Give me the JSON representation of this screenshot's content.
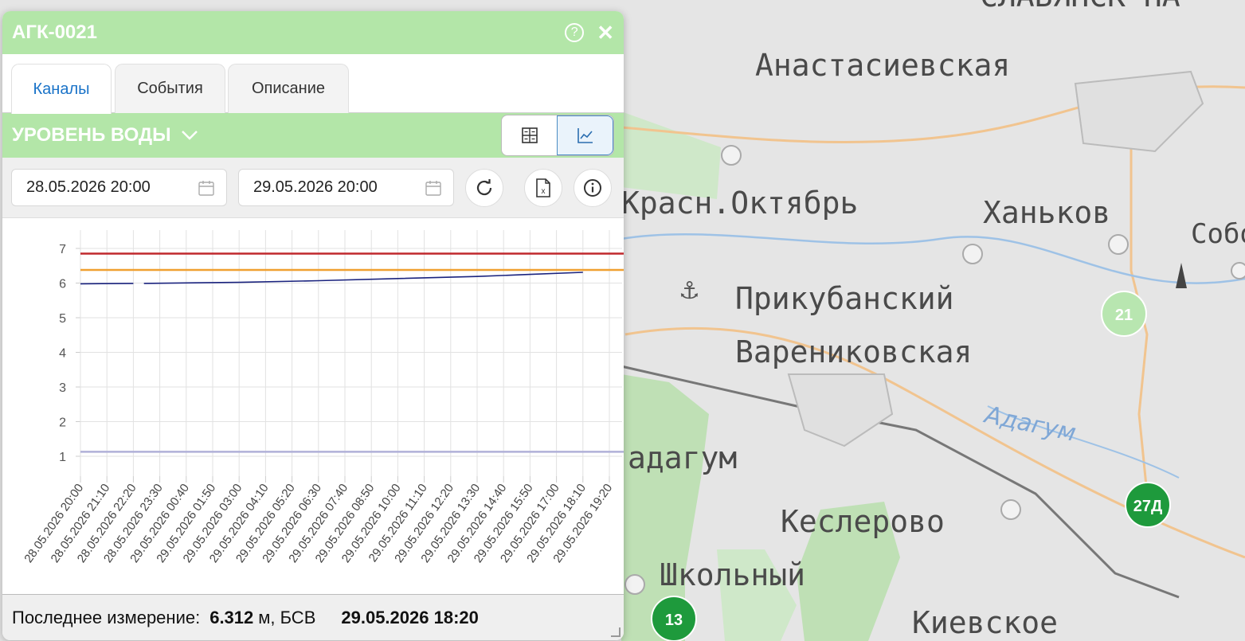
{
  "window": {
    "title": "АГК-0021",
    "help_icon": "help-icon",
    "close_icon": "close-icon"
  },
  "tabs": [
    {
      "label": "Каналы",
      "active": true
    },
    {
      "label": "События",
      "active": false
    },
    {
      "label": "Описание",
      "active": false
    }
  ],
  "channel": {
    "selected": "УРОВЕНЬ ВОДЫ",
    "view_modes": [
      "table-view-icon",
      "chart-view-icon"
    ],
    "active_view": "chart"
  },
  "filters": {
    "date_from": "28.05.2026 20:00",
    "date_to": "29.05.2026 20:00",
    "buttons": [
      "refresh-icon",
      "excel-export-icon",
      "info-icon"
    ]
  },
  "chart_data": {
    "type": "line",
    "ylim": [
      0,
      7
    ],
    "y_ticks": [
      "1",
      "2",
      "3",
      "4",
      "5",
      "6",
      "7"
    ],
    "x_ticks": [
      "28.05.2026 20:00",
      "28.05.2026 21:10",
      "28.05.2026 22:20",
      "28.05.2026 23:30",
      "29.05.2026 00:40",
      "29.05.2026 01:50",
      "29.05.2026 03:00",
      "29.05.2026 04:10",
      "29.05.2026 05:20",
      "29.05.2026 06:30",
      "29.05.2026 07:40",
      "29.05.2026 08:50",
      "29.05.2026 10:00",
      "29.05.2026 11:10",
      "29.05.2026 12:20",
      "29.05.2026 13:30",
      "29.05.2026 14:40",
      "29.05.2026 15:50",
      "29.05.2026 17:00",
      "29.05.2026 18:10",
      "29.05.2026 19:20"
    ],
    "grid": true,
    "thresholds": [
      {
        "value": 6.85,
        "color": "#c0282d"
      },
      {
        "value": 6.38,
        "color": "#f0a030"
      },
      {
        "value": 1.13,
        "color": "#b0b0d8"
      }
    ],
    "series": [
      {
        "color": "#1a237e",
        "segments": [
          [
            [
              0,
              5.98
            ],
            [
              2.0,
              5.99
            ]
          ],
          [
            [
              2.4,
              5.99
            ],
            [
              6,
              6.02
            ],
            [
              9,
              6.07
            ],
            [
              12,
              6.13
            ],
            [
              15,
              6.19
            ],
            [
              17,
              6.25
            ],
            [
              19,
              6.31
            ]
          ]
        ]
      }
    ]
  },
  "footer": {
    "label": "Последнее измерение:",
    "value": "6.312",
    "unit": "м, БСВ",
    "timestamp": "29.05.2026 18:20"
  },
  "map": {
    "labels": [
      "Анастасиевская",
      "Красн.Октябрь",
      "Ханьков",
      "Собо",
      "Прикубанский",
      "Варениковская",
      "Адагум",
      "адагум",
      "Кеслерово",
      "Школьный",
      "Киевское",
      "СЛАВЯНСК-НА"
    ],
    "markers": [
      {
        "label": "21",
        "color": "#b8e6b0"
      },
      {
        "label": "27Д",
        "color": "#1e9a3c"
      },
      {
        "label": "13",
        "color": "#1e9a3c"
      }
    ]
  }
}
